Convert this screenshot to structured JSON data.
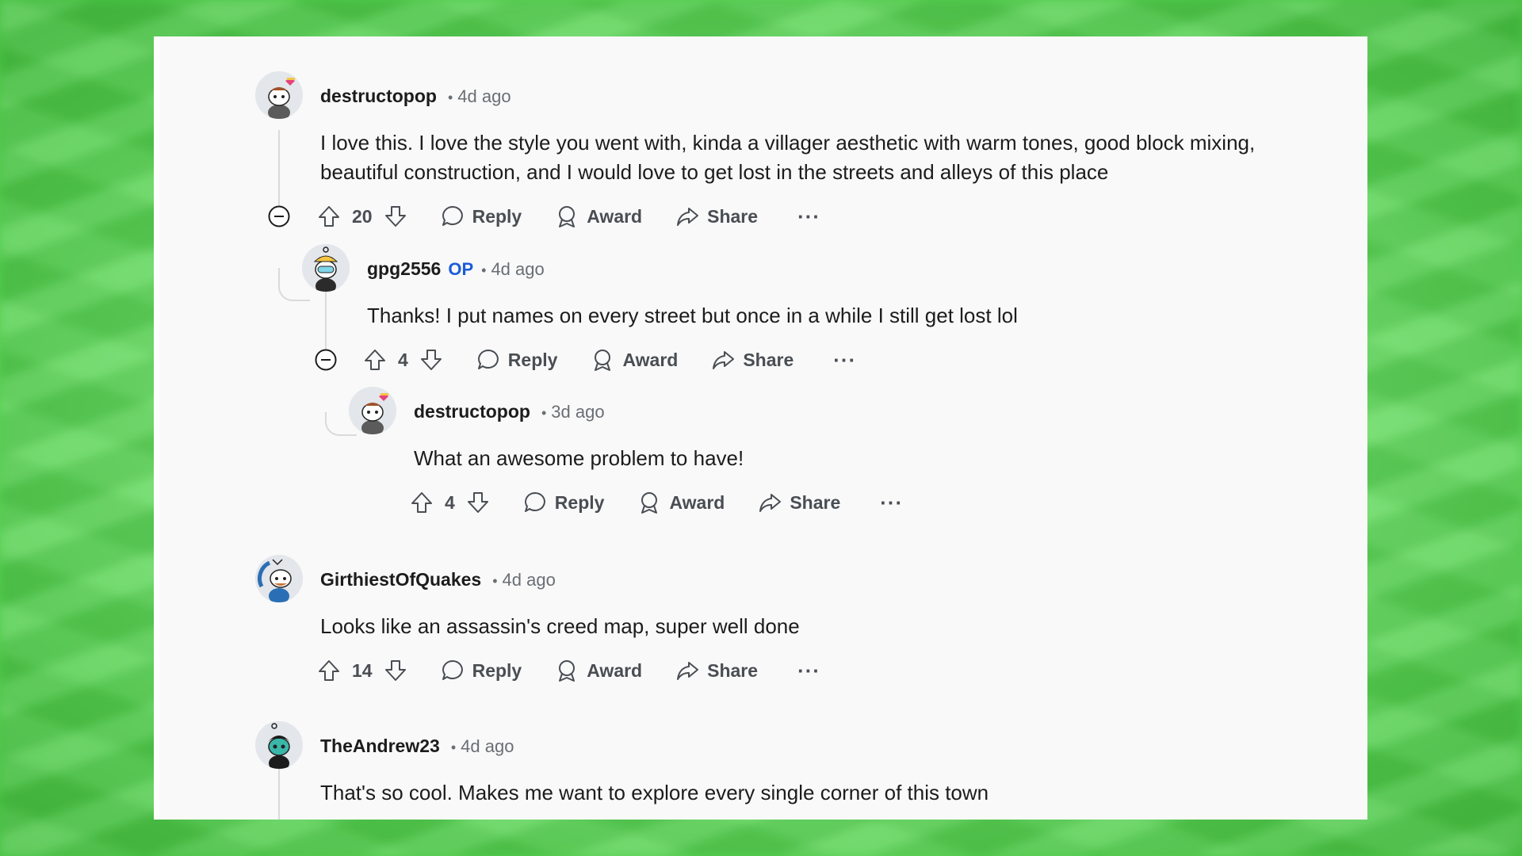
{
  "comments": [
    {
      "username": "destructopop",
      "time": "4d ago",
      "body": [
        "I love this. I love the style you went with, kinda a villager aesthetic with warm tones, good block mixing,",
        "beautiful construction, and I would love to get lost in the streets and alleys of this place"
      ],
      "votes": "20",
      "reply": "Reply",
      "award": "Award",
      "share": "Share",
      "more": "···"
    },
    {
      "username": "gpg2556",
      "op_badge": "OP",
      "time": "4d ago",
      "body": [
        "Thanks! I put names on every street but once in a while I still get lost lol"
      ],
      "votes": "4",
      "reply": "Reply",
      "award": "Award",
      "share": "Share",
      "more": "···"
    },
    {
      "username": "destructopop",
      "time": "3d ago",
      "body": [
        "What an awesome problem to have!"
      ],
      "votes": "4",
      "reply": "Reply",
      "award": "Award",
      "share": "Share",
      "more": "···"
    },
    {
      "username": "GirthiestOfQuakes",
      "time": "4d ago",
      "body": [
        "Looks like an assassin's creed map, super well done"
      ],
      "votes": "14",
      "reply": "Reply",
      "award": "Award",
      "share": "Share",
      "more": "···"
    },
    {
      "username": "TheAndrew23",
      "time": "4d ago",
      "body": [
        "That's so cool. Makes me want to explore every single corner of this town"
      ]
    }
  ],
  "separator": "•",
  "colors": {
    "op": "#1a5cd7",
    "background": "#6fe26a",
    "panel": "#f9f9fa"
  }
}
